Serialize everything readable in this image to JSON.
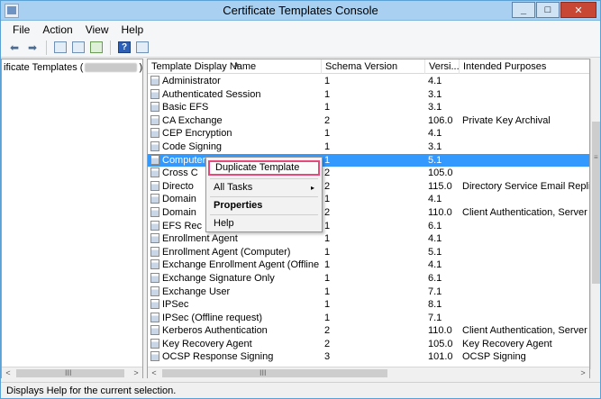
{
  "window": {
    "title": "Certificate Templates Console",
    "controls": {
      "minimize": "_",
      "maximize": "□",
      "close": "✕"
    }
  },
  "menu": [
    "File",
    "Action",
    "View",
    "Help"
  ],
  "toolbar": {
    "icons": [
      "back-arrow-icon",
      "forward-arrow-icon",
      "show-hide-console-tree-icon",
      "properties-icon",
      "export-list-icon",
      "help-icon",
      "show-hide-action-pane-icon"
    ]
  },
  "tree": {
    "label_prefix": "ificate Templates (",
    "label_suffix": ")"
  },
  "list": {
    "columns": [
      "Template Display Name",
      "Schema Version",
      "Versi...",
      "Intended Purposes"
    ],
    "rows": [
      {
        "name": "Administrator",
        "schema": "1",
        "version": "4.1",
        "purposes": ""
      },
      {
        "name": "Authenticated Session",
        "schema": "1",
        "version": "3.1",
        "purposes": ""
      },
      {
        "name": "Basic EFS",
        "schema": "1",
        "version": "3.1",
        "purposes": ""
      },
      {
        "name": "CA Exchange",
        "schema": "2",
        "version": "106.0",
        "purposes": "Private Key Archival"
      },
      {
        "name": "CEP Encryption",
        "schema": "1",
        "version": "4.1",
        "purposes": ""
      },
      {
        "name": "Code Signing",
        "schema": "1",
        "version": "3.1",
        "purposes": ""
      },
      {
        "name": "Computer",
        "schema": "1",
        "version": "5.1",
        "purposes": ""
      },
      {
        "name": "Cross C",
        "schema": "2",
        "version": "105.0",
        "purposes": ""
      },
      {
        "name": "Directo",
        "schema": "2",
        "version": "115.0",
        "purposes": "Directory Service Email Replication"
      },
      {
        "name": "Domain",
        "schema": "1",
        "version": "4.1",
        "purposes": ""
      },
      {
        "name": "Domain",
        "schema": "2",
        "version": "110.0",
        "purposes": "Client Authentication, Server Authentication"
      },
      {
        "name": "EFS Rec",
        "schema": "1",
        "version": "6.1",
        "purposes": ""
      },
      {
        "name": "Enrollment Agent",
        "schema": "1",
        "version": "4.1",
        "purposes": ""
      },
      {
        "name": "Enrollment Agent (Computer)",
        "schema": "1",
        "version": "5.1",
        "purposes": ""
      },
      {
        "name": "Exchange Enrollment Agent (Offline requ...",
        "schema": "1",
        "version": "4.1",
        "purposes": ""
      },
      {
        "name": "Exchange Signature Only",
        "schema": "1",
        "version": "6.1",
        "purposes": ""
      },
      {
        "name": "Exchange User",
        "schema": "1",
        "version": "7.1",
        "purposes": ""
      },
      {
        "name": "IPSec",
        "schema": "1",
        "version": "8.1",
        "purposes": ""
      },
      {
        "name": "IPSec (Offline request)",
        "schema": "1",
        "version": "7.1",
        "purposes": ""
      },
      {
        "name": "Kerberos Authentication",
        "schema": "2",
        "version": "110.0",
        "purposes": "Client Authentication, Server Authentication"
      },
      {
        "name": "Key Recovery Agent",
        "schema": "2",
        "version": "105.0",
        "purposes": "Key Recovery Agent"
      },
      {
        "name": "OCSP Response Signing",
        "schema": "3",
        "version": "101.0",
        "purposes": "OCSP Signing"
      }
    ],
    "selected_index": 6
  },
  "context_menu": {
    "items": [
      "Duplicate Template",
      "All Tasks",
      "Properties",
      "Help"
    ],
    "submenu_arrow": "▸"
  },
  "scroll": {
    "left_grip": "III",
    "right_grip": "III",
    "left_arrow": "<",
    "right_arrow": ">"
  },
  "status": "Displays Help for the current selection."
}
